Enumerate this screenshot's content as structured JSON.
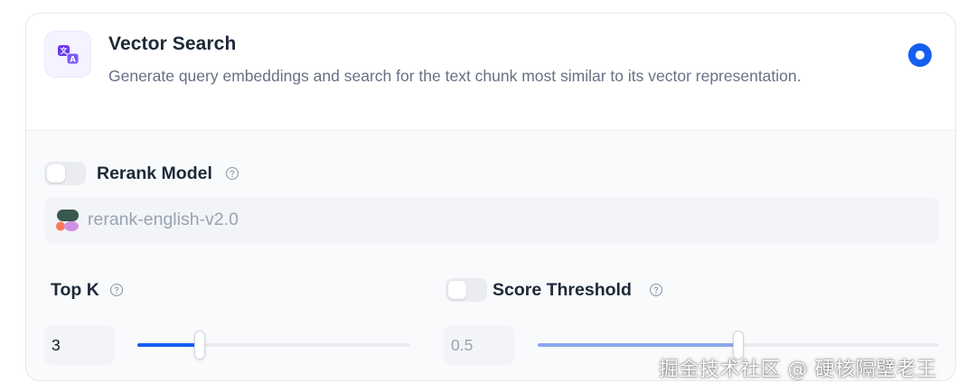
{
  "method": {
    "title": "Vector Search",
    "description": "Generate query embeddings and search for the text chunk most similar to its vector representation.",
    "icon": "translate-icon",
    "selected": true,
    "accent_color": "#155eef"
  },
  "rerank": {
    "label": "Rerank Model",
    "enabled": false,
    "model": "rerank-english-v2.0",
    "model_icon": "cohere-logo-icon"
  },
  "top_k": {
    "label": "Top K",
    "value": "3",
    "slider_fraction": 0.23
  },
  "score_threshold": {
    "label": "Score Threshold",
    "enabled": false,
    "value": "0.5",
    "slider_fraction": 0.5
  },
  "watermark": "掘金技术社区 @ 硬核隔壁老王"
}
